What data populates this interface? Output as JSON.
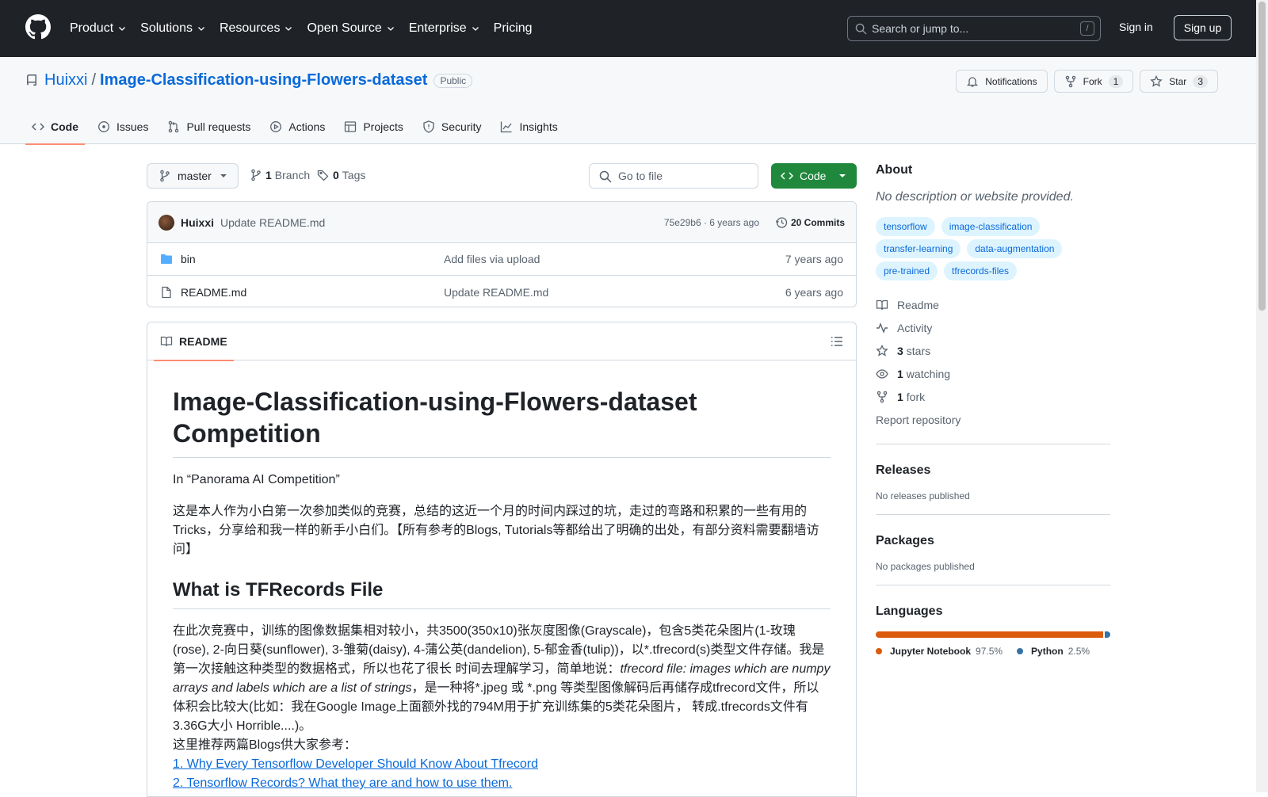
{
  "header": {
    "nav": [
      {
        "label": "Product",
        "has_menu": true
      },
      {
        "label": "Solutions",
        "has_menu": true
      },
      {
        "label": "Resources",
        "has_menu": true
      },
      {
        "label": "Open Source",
        "has_menu": true
      },
      {
        "label": "Enterprise",
        "has_menu": true
      },
      {
        "label": "Pricing",
        "has_menu": false
      }
    ],
    "search_placeholder": "Search or jump to...",
    "search_shortcut": "/",
    "signin": "Sign in",
    "signup": "Sign up"
  },
  "repo": {
    "owner": "Huixxi",
    "separator": "/",
    "name": "Image-Classification-using-Flowers-dataset",
    "visibility": "Public",
    "notifications": "Notifications",
    "fork_label": "Fork",
    "fork_count": "1",
    "star_label": "Star",
    "star_count": "3",
    "tabs": [
      {
        "label": "Code",
        "icon": "code-icon"
      },
      {
        "label": "Issues",
        "icon": "issue-icon"
      },
      {
        "label": "Pull requests",
        "icon": "pull-request-icon"
      },
      {
        "label": "Actions",
        "icon": "play-icon"
      },
      {
        "label": "Projects",
        "icon": "table-icon"
      },
      {
        "label": "Security",
        "icon": "shield-icon"
      },
      {
        "label": "Insights",
        "icon": "graph-icon"
      }
    ]
  },
  "toolbar": {
    "branch": "master",
    "branch_count": "1",
    "branch_label": "Branch",
    "tag_count": "0",
    "tag_label": "Tags",
    "goto_placeholder": "Go to file",
    "code_label": "Code"
  },
  "commit": {
    "author": "Huixxi",
    "message": "Update README.md",
    "hash_time": "75e29b6 · 6 years ago",
    "commits": "20 Commits"
  },
  "files": [
    {
      "name": "bin",
      "type": "folder",
      "message": "Add files via upload",
      "date": "7 years ago"
    },
    {
      "name": "README.md",
      "type": "file",
      "message": "Update README.md",
      "date": "6 years ago"
    }
  ],
  "readme": {
    "tab": "README",
    "h1": "Image-Classification-using-Flowers-dataset Competition",
    "p1": "In “Panorama AI Competition”",
    "p2": "这是本人作为小白第一次参加类似的竞赛，总结的这近一个月的时间内踩过的坑，走过的弯路和积累的一些有用的Tricks，分享给和我一样的新手小白们。【所有参考的Blogs, Tutorials等都给出了明确的出处，有部分资料需要翻墙访问】",
    "h2": "What is TFRecords File",
    "p3a": "在此次竞赛中，训练的图像数据集相对较小，共3500(350x10)张灰度图像(Grayscale)，包含5类花朵图片(1-玫瑰(rose), 2-向日葵(sunflower), 3-雏菊(daisy), 4-蒲公英(dandelion), 5-郁金香(tulip))，以*.tfrecord(s)类型文件存储。我是第一次接触这种类型的数据格式，所以也花了很长 时间去理解学习，简单地说：",
    "p3b": "tfrecord file: images which are numpy arrays and labels which are a list of strings",
    "p3c": "，是一种将*.jpeg 或 *.png 等类型图像解码后再储存成tfrecord文件，所以体积会比较大(比如：我在Google Image上面额外找的794M用于扩充训练集的5类花朵图片， 转成.tfrecords文件有3.36G大小 Horrible....)。",
    "p3d": "这里推荐两篇Blogs供大家参考：",
    "link1": "1. Why Every Tensorflow Developer Should Know About Tfrecord",
    "link2": "2. Tensorflow Records? What they are and how to use them."
  },
  "sidebar": {
    "about": "About",
    "description": "No description or website provided.",
    "topics": [
      "tensorflow",
      "image-classification",
      "transfer-learning",
      "data-augmentation",
      "pre-trained",
      "tfrecords-files"
    ],
    "readme": "Readme",
    "activity": "Activity",
    "stars_n": "3",
    "stars_label": "stars",
    "watching_n": "1",
    "watching_label": "watching",
    "fork_n": "1",
    "fork_label": "fork",
    "report": "Report repository",
    "releases": "Releases",
    "no_releases": "No releases published",
    "packages": "Packages",
    "no_packages": "No packages published",
    "languages": "Languages",
    "langs": [
      {
        "name": "Jupyter Notebook",
        "percent": "97.5%",
        "value": 97.5,
        "color": "#DA5B0B"
      },
      {
        "name": "Python",
        "percent": "2.5%",
        "value": 2.5,
        "color": "#3572A5"
      }
    ]
  }
}
